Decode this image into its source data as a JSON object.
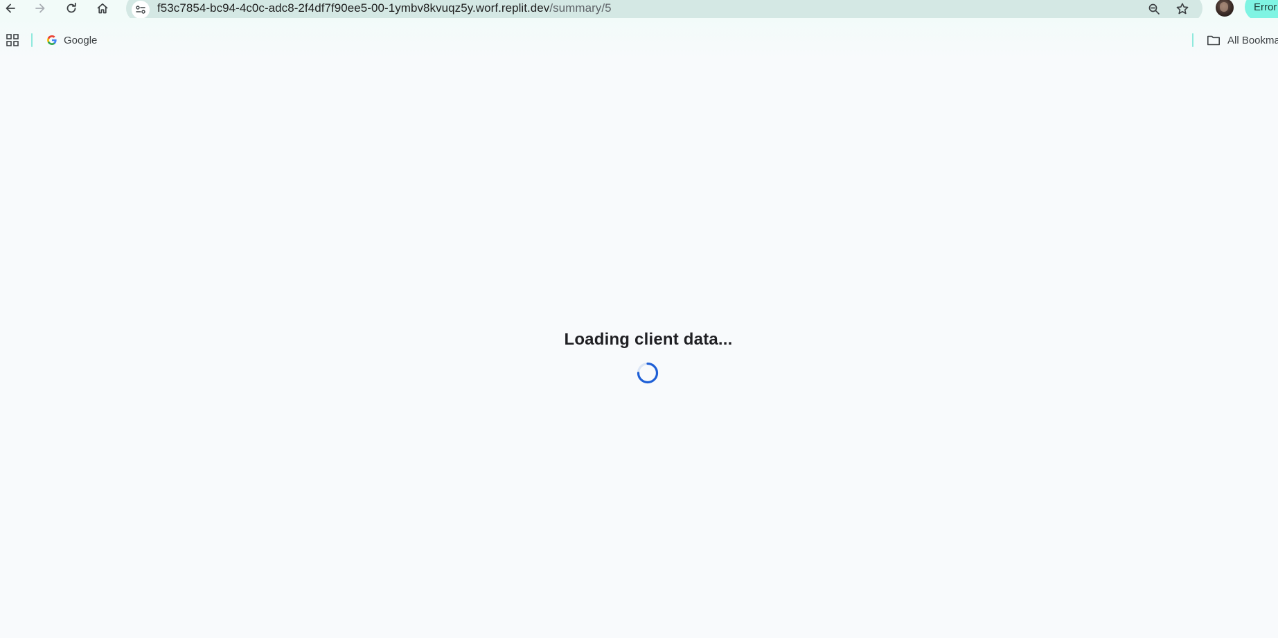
{
  "browser": {
    "url_host": "f53c7854-bc94-4c0c-adc8-2f4df7f90ee5-00-1ymbv8kvuqz5y.worf.replit.dev",
    "url_path": "/summary/5",
    "error_chip_label": "Error",
    "nav_icons": [
      "back-arrow-icon",
      "forward-arrow-icon",
      "reload-icon",
      "home-icon"
    ],
    "omnibox_icons": [
      "site-info-icon",
      "zoom-icon",
      "star-icon"
    ]
  },
  "bookmarks": {
    "items": [
      {
        "label": "Google",
        "icon": "google-icon"
      }
    ],
    "all_bookmarks_label": "All Bookma"
  },
  "main": {
    "loading_text": "Loading client data...",
    "spinner_color": "#1e5fd6"
  },
  "colors": {
    "page_background": "#f8fafc",
    "omnibox_background": "#d4e8e4",
    "accent_chip": "#7ff4e3"
  }
}
